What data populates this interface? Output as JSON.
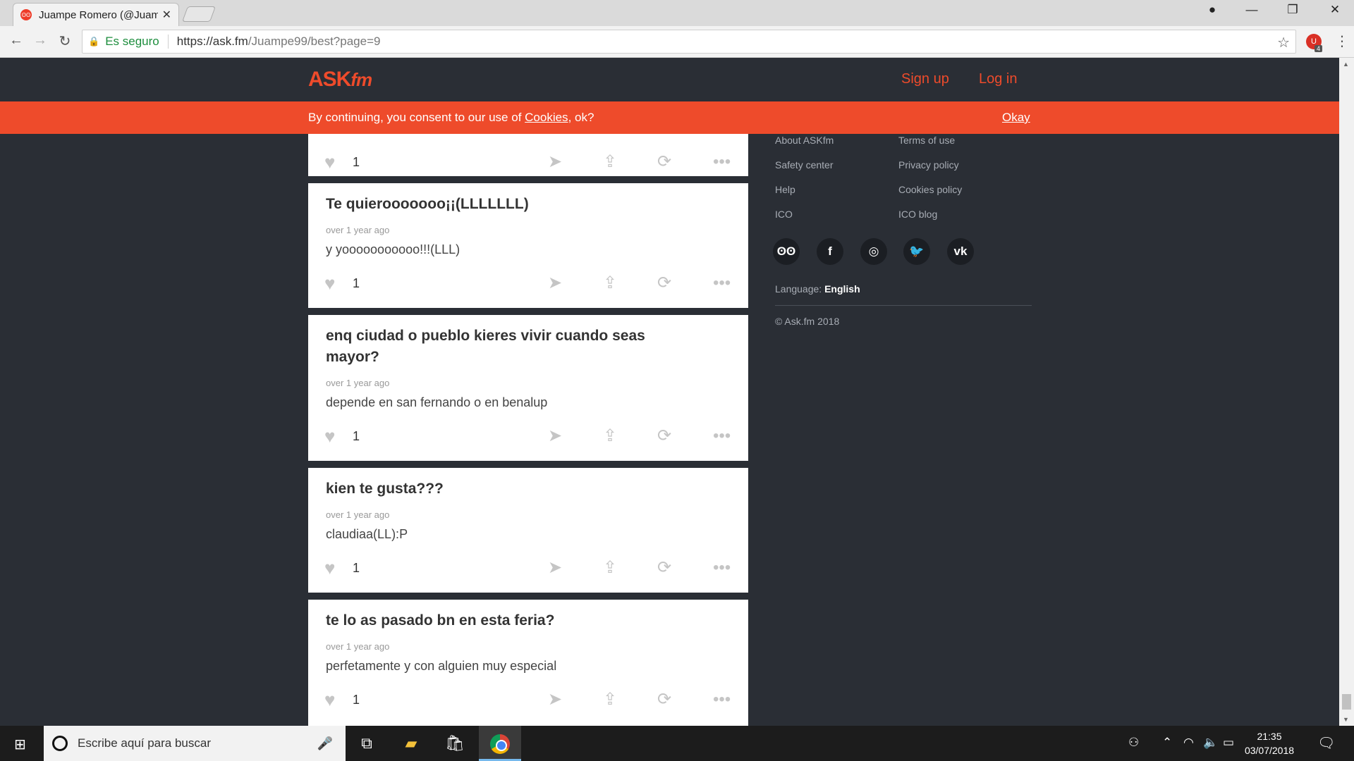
{
  "browser": {
    "tab_title": "Juampe Romero (@Juam",
    "favicon_text": "ʘʘ",
    "secure_label": "Es seguro",
    "url_scheme_host": "https://ask.fm",
    "url_path": "/Juampe99/best?page=9",
    "ext_badge": "4"
  },
  "site": {
    "logo_main": "ASK",
    "logo_suffix": "fm",
    "signup": "Sign up",
    "login": "Log in",
    "accent": "#ee4b2b"
  },
  "cookie_bar": {
    "text_before": "By continuing, you consent to our use of ",
    "link": "Cookies",
    "text_after": ", ok?",
    "okay": "Okay"
  },
  "posts": [
    {
      "likes": "1"
    },
    {
      "question": "Te quierooooooo¡¡(LLLLLLL)",
      "time": "over 1 year ago",
      "answer": "y yooooooooooo!!!(LLL)",
      "likes": "1"
    },
    {
      "question": "enq ciudad o pueblo kieres vivir cuando seas mayor?",
      "time": "over 1 year ago",
      "answer": "depende en san fernando o en benalup",
      "likes": "1"
    },
    {
      "question": "kien te gusta???",
      "time": "over 1 year ago",
      "answer": "claudiaa(LL):P",
      "likes": "1"
    },
    {
      "question": "te lo as pasado bn en esta feria?",
      "time": "over 1 year ago",
      "answer": "perfetamente y con alguien muy especial",
      "likes": "1"
    }
  ],
  "footer": {
    "links_left": [
      "About ASKfm",
      "Safety center",
      "Help",
      "ICO"
    ],
    "links_right": [
      "Terms of use",
      "Privacy policy",
      "Cookies policy",
      "ICO blog"
    ],
    "social_icons": [
      "askfm-icon",
      "facebook-icon",
      "instagram-icon",
      "twitter-icon",
      "vk-icon"
    ],
    "language_label": "Language:",
    "language_value": "English",
    "copyright": "© Ask.fm 2018"
  },
  "taskbar": {
    "search_placeholder": "Escribe aquí para buscar",
    "time": "21:35",
    "date": "03/07/2018"
  }
}
